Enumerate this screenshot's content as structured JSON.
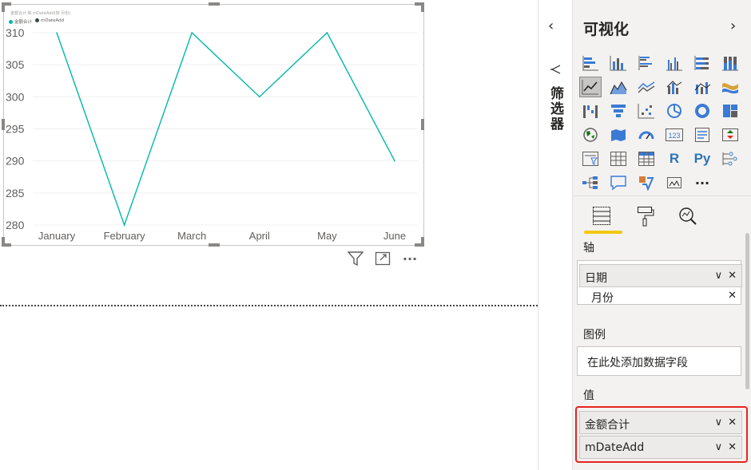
{
  "visual": {
    "title": "金额合计 和 mDateAdd(按 月份)",
    "legend": [
      {
        "label": "金额合计",
        "color": "#01b8aa"
      },
      {
        "label": "mDateAdd",
        "color": "#374649"
      }
    ]
  },
  "chart_data": {
    "type": "line",
    "categories": [
      "January",
      "February",
      "March",
      "April",
      "May",
      "June"
    ],
    "series": [
      {
        "name": "金额合计",
        "values": [
          310,
          280,
          310,
          300,
          310,
          290
        ],
        "color": "#01b8aa"
      }
    ],
    "yticks": [
      "310",
      "305",
      "300",
      "295",
      "290",
      "285",
      "280"
    ],
    "ylim": [
      280,
      310
    ],
    "grid": true,
    "legend_position": "top-left"
  },
  "visual_toolbar": {
    "filter_icon": "filter-icon",
    "focus_icon": "focus-mode-icon",
    "more_icon": "more-options-icon",
    "more_label": "···"
  },
  "filters_pane": {
    "label": "筛选器",
    "collapse_glyph": "‹"
  },
  "viz_pane": {
    "title": "可视化",
    "expand_glyph": "›",
    "r_label": "R",
    "py_label": "Py",
    "kpi_label": "123",
    "more_visuals": "···",
    "axis_label": "轴",
    "axis_fields": [
      {
        "label": "日期"
      },
      {
        "label": "月份"
      }
    ],
    "legend_label": "图例",
    "legend_placeholder": "在此处添加数据字段",
    "values_label": "值",
    "value_fields": [
      {
        "label": "金额合计"
      },
      {
        "label": "mDateAdd"
      }
    ],
    "highlight_color": "#e8231f",
    "accent_color": "#f2c811"
  }
}
